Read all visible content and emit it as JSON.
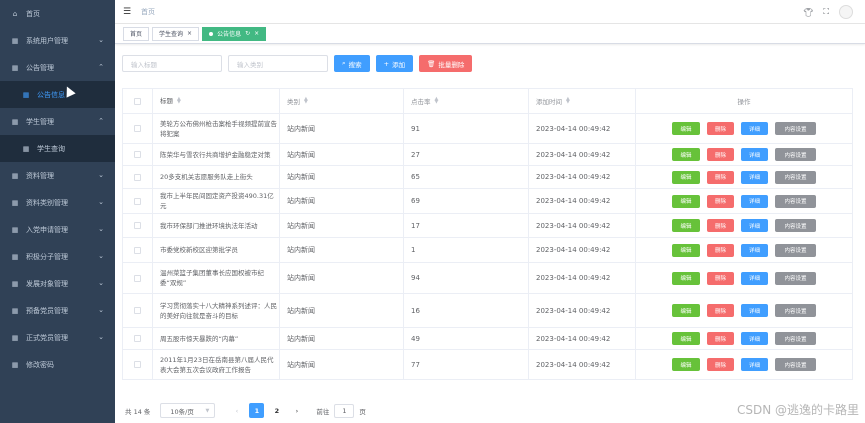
{
  "sidebar": {
    "items": [
      {
        "label": "首页",
        "icon": "home-icon",
        "arrow": ""
      },
      {
        "label": "系统用户管理",
        "icon": "grid-icon",
        "arrow": "⌄"
      },
      {
        "label": "公告管理",
        "icon": "grid-icon",
        "arrow": "⌃"
      },
      {
        "label": "公告信息",
        "icon": "grid-icon",
        "arrow": ""
      },
      {
        "label": "学生管理",
        "icon": "grid-icon",
        "arrow": "⌃"
      },
      {
        "label": "学生查询",
        "icon": "grid-icon",
        "arrow": ""
      },
      {
        "label": "资料管理",
        "icon": "grid-icon",
        "arrow": "⌄"
      },
      {
        "label": "资料类别管理",
        "icon": "grid-icon",
        "arrow": "⌄"
      },
      {
        "label": "入党申请管理",
        "icon": "grid-icon",
        "arrow": "⌄"
      },
      {
        "label": "积极分子管理",
        "icon": "grid-icon",
        "arrow": "⌄"
      },
      {
        "label": "发展对象管理",
        "icon": "grid-icon",
        "arrow": "⌄"
      },
      {
        "label": "预备党员管理",
        "icon": "grid-icon",
        "arrow": "⌄"
      },
      {
        "label": "正式党员管理",
        "icon": "grid-icon",
        "arrow": "⌄"
      },
      {
        "label": "修改密码",
        "icon": "grid-icon",
        "arrow": ""
      }
    ]
  },
  "navbar": {
    "breadcrumb": "首页",
    "icons": [
      "shirt-icon",
      "fullscreen-icon",
      "avatar"
    ]
  },
  "tags": {
    "items": [
      {
        "label": "首页",
        "close": ""
      },
      {
        "label": "学生查询",
        "close": "×"
      },
      {
        "label": "公告信息",
        "close": "×"
      }
    ],
    "active_refresh": "↻"
  },
  "search": {
    "title_placeholder": "输入标题",
    "category_placeholder": "输入类别",
    "search_label": "搜索",
    "add_label": "添加",
    "batch_delete_label": "批量删除"
  },
  "table": {
    "headers": {
      "title": "标题",
      "category": "类别",
      "clicks": "点击率",
      "time": "添加时间",
      "ops": "操作"
    },
    "ops": {
      "edit": "编辑",
      "delete": "删除",
      "detail": "详细",
      "content": "内容设置"
    },
    "rows": [
      {
        "title": "美轮方公布佛州枪击案枪手视频提前宣告将犯案",
        "category": "站内新闻",
        "clicks": "91",
        "time": "2023-04-14 00:49:42"
      },
      {
        "title": "陈荣华与雪农行共商增护金融稳定对策",
        "category": "站内新闻",
        "clicks": "27",
        "time": "2023-04-14 00:49:42"
      },
      {
        "title": "20多支机关志愿服务队走上街头",
        "category": "站内新闻",
        "clicks": "65",
        "time": "2023-04-14 00:49:42"
      },
      {
        "title": "我市上半年民间固定资产投资490.31亿元",
        "category": "站内新闻",
        "clicks": "69",
        "time": "2023-04-14 00:49:42"
      },
      {
        "title": "我市环保部门推进环境执法年活动",
        "category": "站内新闻",
        "clicks": "17",
        "time": "2023-04-14 00:49:42"
      },
      {
        "title": "市委党校新校区迎第批学员",
        "category": "站内新闻",
        "clicks": "1",
        "time": "2023-04-14 00:49:42"
      },
      {
        "title": "温州菜篮子集团董事长应国权被市纪委“双规”",
        "category": "站内新闻",
        "clicks": "94",
        "time": "2023-04-14 00:49:42"
      },
      {
        "title": "学习贯彻落实十八大精神系列述评：人民的美好向往就是奋斗的目标",
        "category": "站内新闻",
        "clicks": "16",
        "time": "2023-04-14 00:49:42"
      },
      {
        "title": "周五股市惊天暴跌的“内幕”",
        "category": "站内新闻",
        "clicks": "49",
        "time": "2023-04-14 00:49:42"
      },
      {
        "title": "2011年1月23日在岳南县第八届人民代表大会第五次会议政府工作报告",
        "category": "站内新闻",
        "clicks": "77",
        "time": "2023-04-14 00:49:42"
      }
    ]
  },
  "pagination": {
    "total": "共 14 条",
    "page_size": "10条/页",
    "pages": [
      "1",
      "2"
    ],
    "current": "1",
    "goto_label": "前往",
    "goto_value": "1",
    "page_suffix": "页"
  },
  "watermark": "CSDN @逃逸的卡路里",
  "colors": {
    "sidebar_bg": "#304156",
    "primary": "#409eff",
    "success": "#67c23a",
    "danger": "#f56c6c",
    "info": "#909399",
    "tag_active": "#42b983"
  }
}
